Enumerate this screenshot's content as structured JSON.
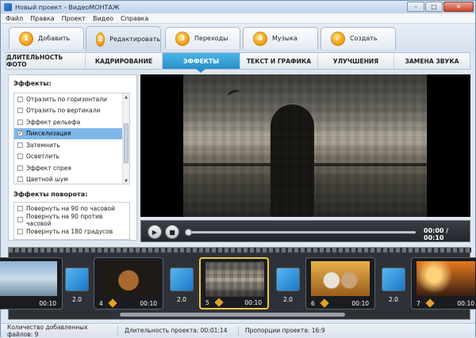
{
  "window": {
    "title": "Новый проект - ВидеоМОНТАЖ"
  },
  "menu": [
    "Файл",
    "Правка",
    "Проект",
    "Видео",
    "Справка"
  ],
  "steps": [
    {
      "num": "1",
      "label": "Добавить"
    },
    {
      "num": "2",
      "label": "Редактировать"
    },
    {
      "num": "3",
      "label": "Переходы"
    },
    {
      "num": "4",
      "label": "Музыка"
    },
    {
      "num": "✓",
      "label": "Создать"
    }
  ],
  "subtabs": [
    "ДЛИТЕЛЬНОСТЬ ФОТО",
    "КАДРИРОВАНИЕ",
    "ЭФФЕКТЫ",
    "ТЕКСТ И ГРАФИКА",
    "УЛУЧШЕНИЯ",
    "ЗАМЕНА ЗВУКА"
  ],
  "effects": {
    "heading": "Эффекты:",
    "items": [
      "Отразить по горизонтали",
      "Отразить по вертикали",
      "Эффект рельефа",
      "Пикселизация",
      "Затемнить",
      "Осветлить",
      "Эффект спрея",
      "Цветной шум"
    ],
    "selected": "Пикселизация"
  },
  "rotation": {
    "heading": "Эффекты поворота:",
    "items": [
      "Повернуть на 90 по часовой",
      "Повернуть на 90 против часовой",
      "Повернуть на 180 градусов"
    ]
  },
  "player": {
    "time": "00:00 / 00:10",
    "progress": 0
  },
  "timeline": {
    "clips": [
      {
        "num": "",
        "duration": "00:10"
      },
      {
        "num": "4",
        "duration": "00:10"
      },
      {
        "num": "5",
        "duration": "00:10"
      },
      {
        "num": "6",
        "duration": "00:10"
      },
      {
        "num": "7",
        "duration": "00:10"
      }
    ],
    "transitions": [
      "2.0",
      "2.0",
      "2.0",
      "2.0"
    ]
  },
  "status": {
    "files": "Количество добавленных файлов: 9",
    "duration": "Длительность проекта: 00:01:14",
    "ratio": "Пропорции проекта: 16:9"
  }
}
